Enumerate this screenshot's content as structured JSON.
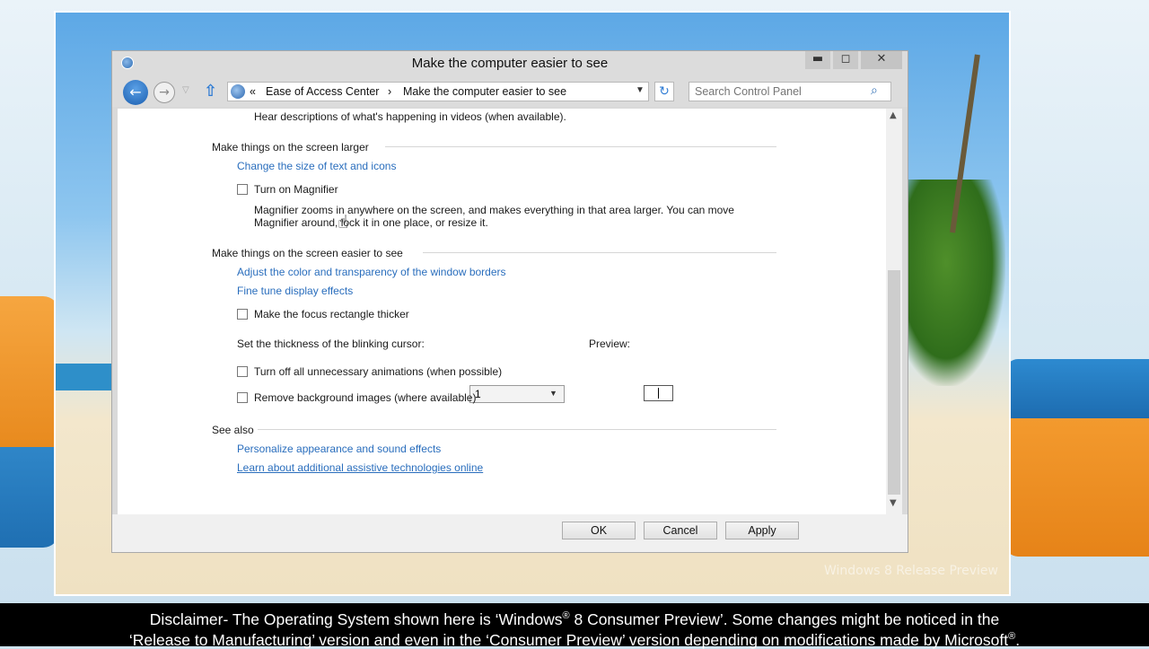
{
  "window": {
    "title": "Make the computer easier to see",
    "controls": {
      "minimize": "▬",
      "maximize": "◻",
      "close": "✕"
    }
  },
  "navbar": {
    "back_glyph": "←",
    "forward_glyph": "→",
    "history_glyph": "▽",
    "up_glyph": "⇧",
    "breadcrumb_prefix": "«",
    "breadcrumbs": [
      "Ease of Access Center",
      "Make the computer easier to see"
    ],
    "breadcrumb_separator": "›",
    "dropdown_glyph": "▼",
    "refresh_glyph": "↻",
    "search_placeholder": "Search Control Panel",
    "search_glyph": "⌕"
  },
  "content": {
    "top_text": "Hear descriptions of what's happening in videos (when available).",
    "sections": {
      "larger": {
        "heading": "Make things on the screen larger",
        "link_change_size": "Change the size of text and icons",
        "magnifier_label": "Turn on Magnifier",
        "magnifier_desc_line1": "Magnifier zooms in anywhere on the screen, and makes everything in that area larger. You can move",
        "magnifier_desc_line2": "Magnifier around, lock it in one place, or resize it."
      },
      "easier": {
        "heading": "Make things on the screen easier to see",
        "link_color": "Adjust the color and transparency of the window borders",
        "link_display": "Fine tune display effects",
        "focus_label": "Make the focus rectangle thicker",
        "cursor_label": "Set the thickness of the blinking cursor:",
        "cursor_value": "1",
        "preview_label": "Preview:",
        "animations_label": "Turn off all unnecessary animations (when possible)",
        "background_label": "Remove background images (where available)"
      },
      "see_also": {
        "heading": "See also",
        "link_personalize": "Personalize appearance and sound effects",
        "link_learn": "Learn about additional assistive technologies online"
      }
    },
    "scroll_up_glyph": "▲",
    "scroll_down_glyph": "▼"
  },
  "buttons": {
    "ok": "OK",
    "cancel": "Cancel",
    "apply": "Apply"
  },
  "desktop": {
    "watermark": "Windows 8 Release Preview"
  },
  "disclaimer": {
    "line1_a": "Disclaimer- The Operating System shown here is ‘Windows",
    "line1_sup": "®",
    "line1_b": " 8 Consumer Preview’. Some changes might be noticed in the",
    "line2_a": "‘Release to Manufacturing’ version and even in the ‘Consumer Preview’ version depending on modifications made by Microsoft",
    "line2_sup": "®",
    "line2_b": "."
  },
  "colors": {
    "link": "#2a6ebd",
    "accent": "#2e7bd4"
  }
}
